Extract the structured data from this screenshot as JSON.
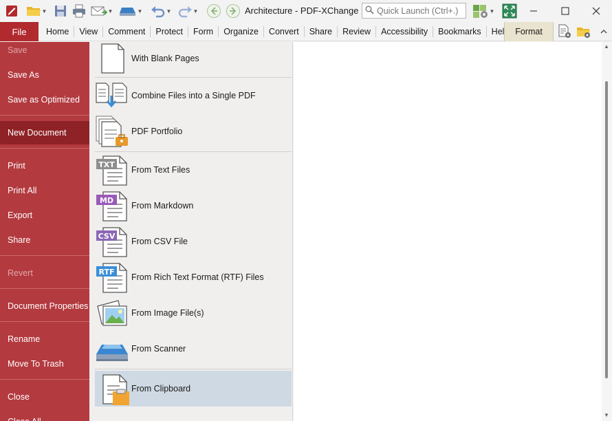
{
  "window": {
    "title": "Architecture - PDF-XChange E..",
    "quick_launch_placeholder": "Quick Launch (Ctrl+.)"
  },
  "ribbon": {
    "file_tab": "File",
    "tabs": [
      "Home",
      "View",
      "Comment",
      "Protect",
      "Form",
      "Organize",
      "Convert",
      "Share",
      "Review",
      "Accessibility",
      "Bookmarks",
      "Help"
    ],
    "format_tab": "Format"
  },
  "backstage": {
    "menu": [
      {
        "label": "Save",
        "state": "disabled"
      },
      {
        "label": "Save As",
        "state": "normal"
      },
      {
        "label": "Save as Optimized",
        "state": "normal"
      },
      {
        "label": "New Document",
        "state": "selected"
      },
      {
        "label": "Print",
        "state": "normal"
      },
      {
        "label": "Print All",
        "state": "normal"
      },
      {
        "label": "Export",
        "state": "normal"
      },
      {
        "label": "Share",
        "state": "normal"
      },
      {
        "label": "Revert",
        "state": "disabled"
      },
      {
        "label": "Document Properties",
        "state": "normal"
      },
      {
        "label": "Rename",
        "state": "normal"
      },
      {
        "label": "Move To Trash",
        "state": "normal"
      },
      {
        "label": "Close",
        "state": "normal"
      },
      {
        "label": "Close All",
        "state": "normal"
      }
    ],
    "new_document_options": [
      {
        "label": "With Blank Pages",
        "icon": "blank-page-icon"
      },
      {
        "label": "Combine Files into a Single PDF",
        "icon": "combine-files-icon"
      },
      {
        "label": "PDF Portfolio",
        "icon": "portfolio-icon"
      },
      {
        "label": "From Text Files",
        "icon": "txt-file-icon",
        "badge": "TXT"
      },
      {
        "label": "From Markdown",
        "icon": "markdown-file-icon",
        "badge": "MD"
      },
      {
        "label": "From CSV File",
        "icon": "csv-file-icon",
        "badge": "CSV"
      },
      {
        "label": "From Rich Text Format (RTF) Files",
        "icon": "rtf-file-icon",
        "badge": "RTF"
      },
      {
        "label": "From Image File(s)",
        "icon": "image-file-icon"
      },
      {
        "label": "From Scanner",
        "icon": "scanner-icon"
      },
      {
        "label": "From Clipboard",
        "icon": "clipboard-icon",
        "selected": true
      }
    ]
  },
  "colors": {
    "file_accent": "#b02a2e",
    "backstage_bg": "#b33a3f",
    "selected_menu": "#8e2226",
    "selected_option": "#cfd9e3"
  }
}
